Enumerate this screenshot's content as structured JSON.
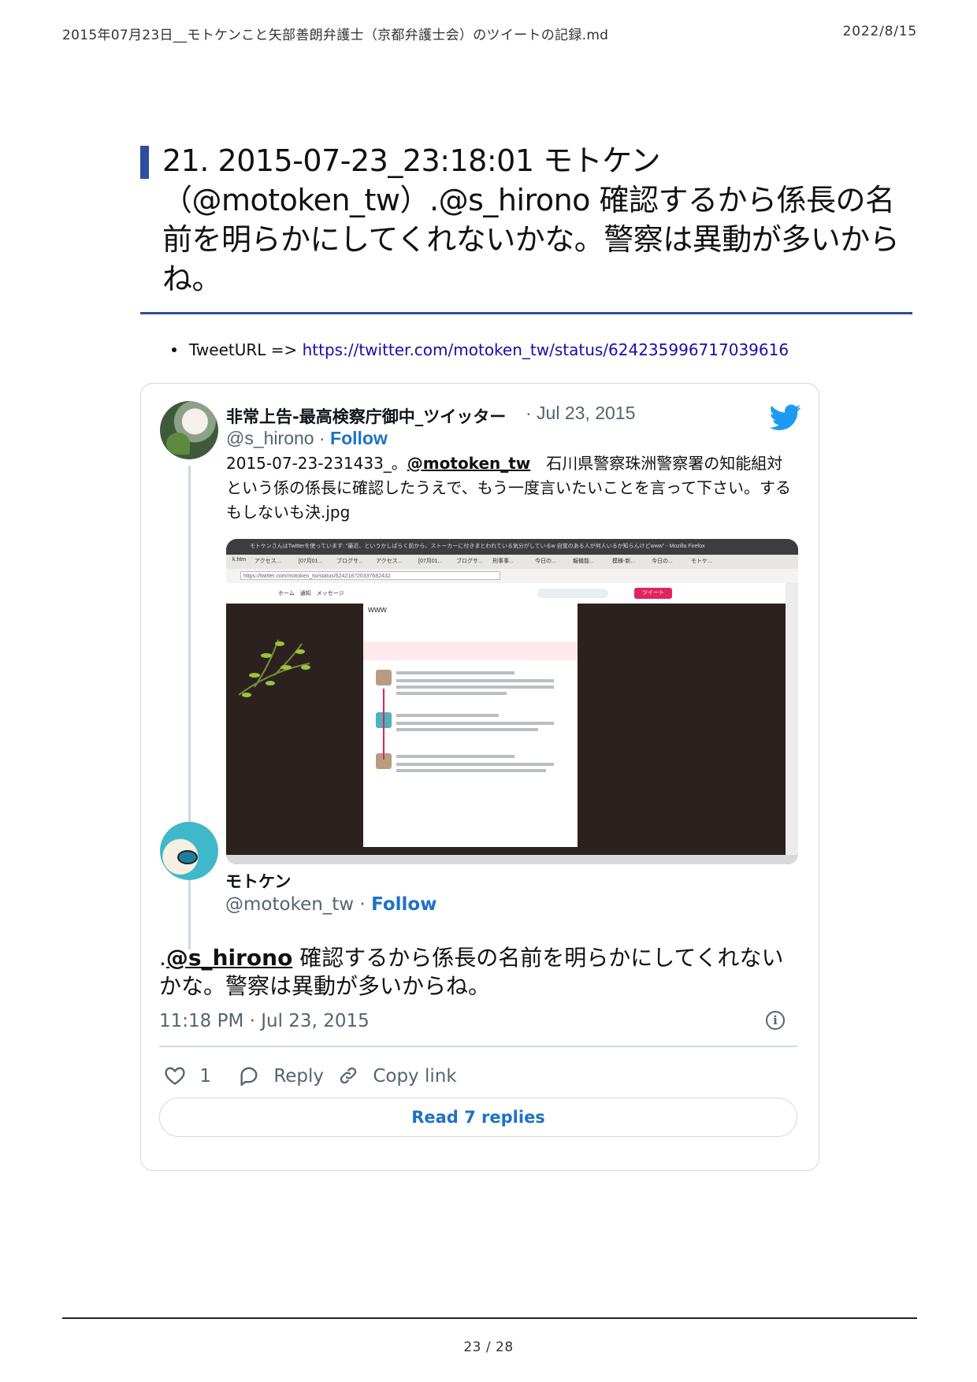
{
  "header": {
    "doc_title": "2015年07月23日__モトケンこと矢部善朗弁護士（京都弁護士会）のツイートの記録.md",
    "date": "2022/8/15"
  },
  "section": {
    "title": "21. 2015-07-23_23:18:01 モトケン（@motoken_tw）.@s_hirono 確認するから係長の名前を明らかにしてくれないかな。警察は異動が多いからね。"
  },
  "tweet_url": {
    "label": "TweetURL =>",
    "url": "https://twitter.com/motoken_tw/status/624235996717039616"
  },
  "embed": {
    "parent": {
      "display_name": "非常上告-最高検察庁御中_ツイッター",
      "date": "· Jul 23, 2015",
      "handle": "@s_hirono · ",
      "follow_label": "Follow",
      "text_prefix": "2015-07-23-231433_。",
      "mention": "@motoken_tw",
      "text_rest": "　石川県警察珠洲警察署の知能組対という係の係長に確認したうえで、もう一度言いたいことを言って下さい。するもしないも決.jpg",
      "screenshot": {
        "window_title": "モトケンさんはTwitterを使っています: \"最近、というかしばらく前から、ストーカーに付きまとわれている気分がしているw 自覚のある人が何人いるか知らんけどwww\" - Mozilla Firefox",
        "tabs": [
          "k.htm",
          "アクセス...",
          "[07月01...",
          "ブログサ...",
          "アクセス...",
          "[07月01...",
          "ブログサ...",
          "刑事事...",
          "今日の...",
          "報機能...",
          "模様-新...",
          "今日の...",
          "モトケ..."
        ],
        "address": "https://twitter.com/motoken_tw/status/624218720337682432",
        "nav_home": "ホーム　通知　メッセージ",
        "tweet_button": "ツイート",
        "www": "www"
      }
    },
    "reply": {
      "display_name": "モトケン",
      "handle": "@motoken_tw · ",
      "follow_label": "Follow",
      "text_prefix": ".",
      "mention": "@s_hirono",
      "text_rest": " 確認するから係長の名前を明らかにしてくれないかな。警察は異動が多いからね。",
      "timestamp": "11:18 PM · Jul 23, 2015",
      "likes": "1",
      "reply_label": "Reply",
      "copy_label": "Copy link",
      "read_replies": "Read 7 replies"
    }
  },
  "footer": {
    "page": "23 / 28"
  },
  "colors": {
    "accent": "#2f4d9e",
    "link": "#1a0dab",
    "twitter_blue": "#1d9bf0",
    "follow_blue": "#1d72c8",
    "muted": "#536471"
  }
}
